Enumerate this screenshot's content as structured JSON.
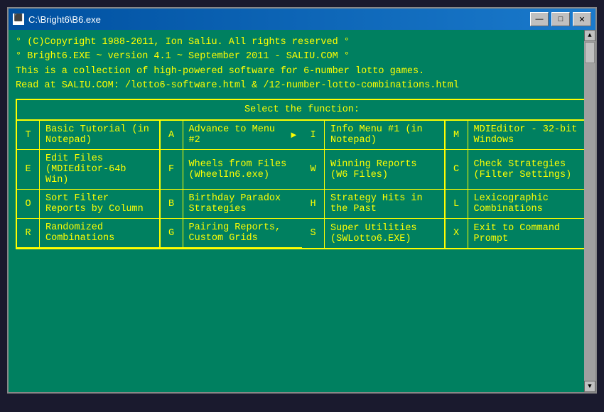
{
  "window": {
    "title": "C:\\Bright6\\B6.exe",
    "minimize_label": "—",
    "maximize_label": "□",
    "close_label": "✕"
  },
  "terminal": {
    "header": [
      "  ° (C)Copyright 1988-2011, Ion Saliu. All rights reserved  °",
      "  ° Bright6.EXE ~ version 4.1 ~ September 2011 - SALIU.COM °",
      "This is a collection of high-powered software for 6-number lotto games.",
      "Read at SALIU.COM: /lotto6-software.html & /12-number-lotto-combinations.html"
    ],
    "menu_title": "Select the function:",
    "menu_rows": [
      {
        "left_key": "T",
        "left_label": "Basic Tutorial (in Notepad)",
        "right_key": "A",
        "right_label": "Advance to Menu #2 ▶"
      },
      {
        "left_key": "I",
        "left_label": "Info Menu #1 (in Notepad)",
        "right_key": "M",
        "right_label": "MDIEditor - 32-bit Windows"
      },
      {
        "left_key": "E",
        "left_label": "Edit Files (MDIEditor-64b Win)",
        "right_key": "F",
        "right_label": "Wheels from Files (WheelIn6.exe)"
      },
      {
        "left_key": "W",
        "left_label": "Winning Reports (W6 Files)",
        "right_key": "C",
        "right_label": "Check Strategies (Filter Settings)"
      },
      {
        "left_key": "O",
        "left_label": "Sort Filter Reports by Column",
        "right_key": "B",
        "right_label": "Birthday Paradox Strategies"
      },
      {
        "left_key": "H",
        "left_label": "Strategy Hits in the Past",
        "right_key": "L",
        "right_label": "Lexicographic Combinations"
      },
      {
        "left_key": "R",
        "left_label": "Randomized Combinations",
        "right_key": "G",
        "right_label": "Pairing Reports, Custom Grids"
      },
      {
        "left_key": "S",
        "left_label": "Super Utilities (SWLotto6.EXE)",
        "right_key": "X",
        "right_label": "Exit to Command Prompt"
      }
    ]
  }
}
